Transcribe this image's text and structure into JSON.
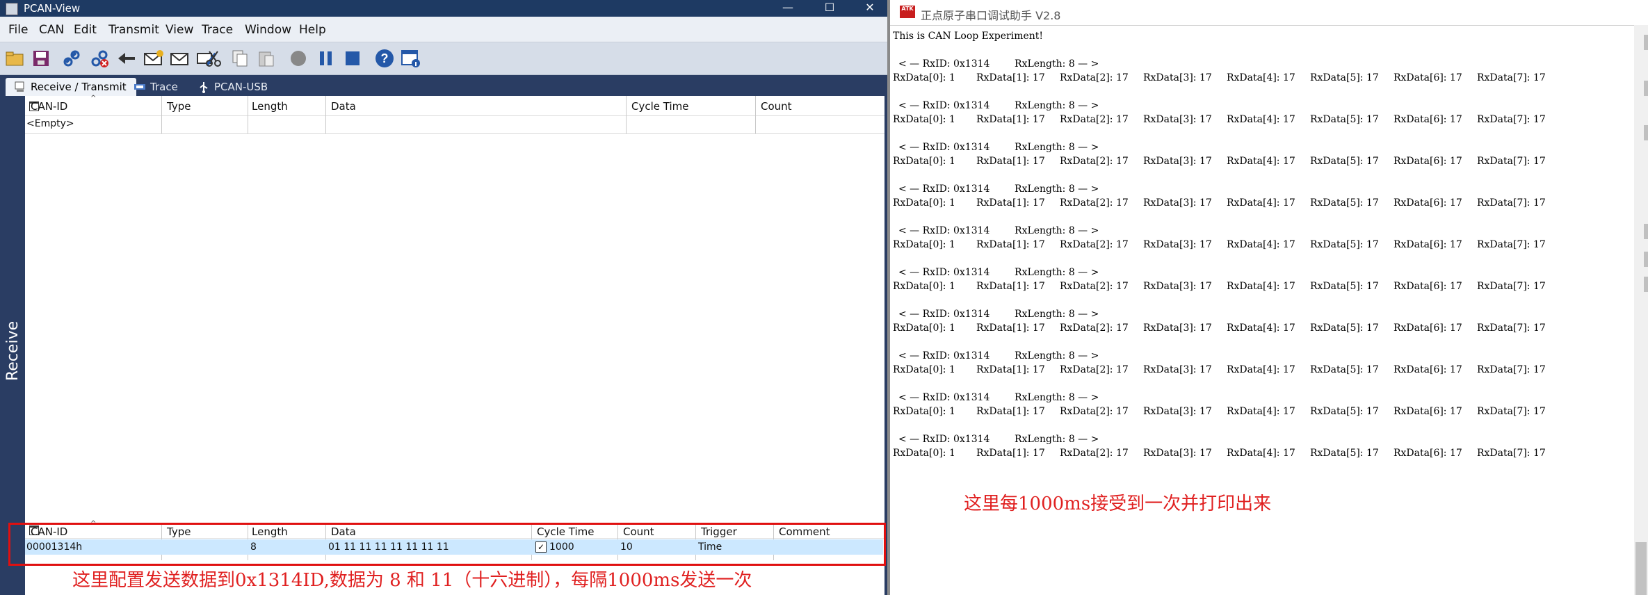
{
  "pcan": {
    "title": "PCAN-View",
    "menu": [
      "File",
      "CAN",
      "Edit",
      "Transmit",
      "View",
      "Trace",
      "Window",
      "Help"
    ],
    "tabs": [
      {
        "label": "Receive / Transmit",
        "active": true
      },
      {
        "label": "Trace",
        "active": false
      },
      {
        "label": "PCAN-USB",
        "active": false
      }
    ],
    "side_label": "Receive",
    "receive": {
      "columns": [
        "CAN-ID",
        "Type",
        "Length",
        "Data",
        "Cycle Time",
        "Count"
      ],
      "empty_text": "<Empty>"
    },
    "transmit": {
      "columns": [
        "CAN-ID",
        "Type",
        "Length",
        "Data",
        "Cycle Time",
        "Count",
        "Trigger",
        "Comment"
      ],
      "rows": [
        {
          "can_id": "00001314h",
          "type": "",
          "length": "8",
          "data": "01 11 11 11 11 11 11 11",
          "cycle_checked": true,
          "cycle_time": "1000",
          "count": "10",
          "trigger": "Time",
          "comment": ""
        }
      ]
    },
    "note": "这里配置发送数据到0x1314ID,数据为 8 和 11（十六进制），每隔1000ms发送一次"
  },
  "serial": {
    "title": "正点原子串口调试助手 V2.8",
    "logo": "ATK",
    "intro": "This is CAN Loop Experiment!",
    "blocks": [
      {
        "header": "< — RxID: 0x1314        RxLength: 8 — >",
        "data": [
          "RxData[0]: 1",
          "RxData[1]: 17",
          "RxData[2]: 17",
          "RxData[3]: 17",
          "RxData[4]: 17",
          "RxData[5]: 17",
          "RxData[6]: 17",
          "RxData[7]: 17"
        ]
      },
      {
        "header": "< — RxID: 0x1314        RxLength: 8 — >",
        "data": [
          "RxData[0]: 1",
          "RxData[1]: 17",
          "RxData[2]: 17",
          "RxData[3]: 17",
          "RxData[4]: 17",
          "RxData[5]: 17",
          "RxData[6]: 17",
          "RxData[7]: 17"
        ]
      },
      {
        "header": "< — RxID: 0x1314        RxLength: 8 — >",
        "data": [
          "RxData[0]: 1",
          "RxData[1]: 17",
          "RxData[2]: 17",
          "RxData[3]: 17",
          "RxData[4]: 17",
          "RxData[5]: 17",
          "RxData[6]: 17",
          "RxData[7]: 17"
        ]
      },
      {
        "header": "< — RxID: 0x1314        RxLength: 8 — >",
        "data": [
          "RxData[0]: 1",
          "RxData[1]: 17",
          "RxData[2]: 17",
          "RxData[3]: 17",
          "RxData[4]: 17",
          "RxData[5]: 17",
          "RxData[6]: 17",
          "RxData[7]: 17"
        ]
      },
      {
        "header": "< — RxID: 0x1314        RxLength: 8 — >",
        "data": [
          "RxData[0]: 1",
          "RxData[1]: 17",
          "RxData[2]: 17",
          "RxData[3]: 17",
          "RxData[4]: 17",
          "RxData[5]: 17",
          "RxData[6]: 17",
          "RxData[7]: 17"
        ]
      },
      {
        "header": "< — RxID: 0x1314        RxLength: 8 — >",
        "data": [
          "RxData[0]: 1",
          "RxData[1]: 17",
          "RxData[2]: 17",
          "RxData[3]: 17",
          "RxData[4]: 17",
          "RxData[5]: 17",
          "RxData[6]: 17",
          "RxData[7]: 17"
        ]
      },
      {
        "header": "< — RxID: 0x1314        RxLength: 8 — >",
        "data": [
          "RxData[0]: 1",
          "RxData[1]: 17",
          "RxData[2]: 17",
          "RxData[3]: 17",
          "RxData[4]: 17",
          "RxData[5]: 17",
          "RxData[6]: 17",
          "RxData[7]: 17"
        ]
      },
      {
        "header": "< — RxID: 0x1314        RxLength: 8 — >",
        "data": [
          "RxData[0]: 1",
          "RxData[1]: 17",
          "RxData[2]: 17",
          "RxData[3]: 17",
          "RxData[4]: 17",
          "RxData[5]: 17",
          "RxData[6]: 17",
          "RxData[7]: 17"
        ]
      },
      {
        "header": "< — RxID: 0x1314        RxLength: 8 — >",
        "data": [
          "RxData[0]: 1",
          "RxData[1]: 17",
          "RxData[2]: 17",
          "RxData[3]: 17",
          "RxData[4]: 17",
          "RxData[5]: 17",
          "RxData[6]: 17",
          "RxData[7]: 17"
        ]
      },
      {
        "header": "< — RxID: 0x1314        RxLength: 8 — >",
        "data": [
          "RxData[0]: 1",
          "RxData[1]: 17",
          "RxData[2]: 17",
          "RxData[3]: 17",
          "RxData[4]: 17",
          "RxData[5]: 17",
          "RxData[6]: 17",
          "RxData[7]: 17"
        ]
      }
    ],
    "note": "这里每1000ms接受到一次并打印出来"
  },
  "colors": {
    "annotation": "#e02020",
    "pcan_frame": "#2a3d63",
    "selection": "#cce8ff"
  }
}
